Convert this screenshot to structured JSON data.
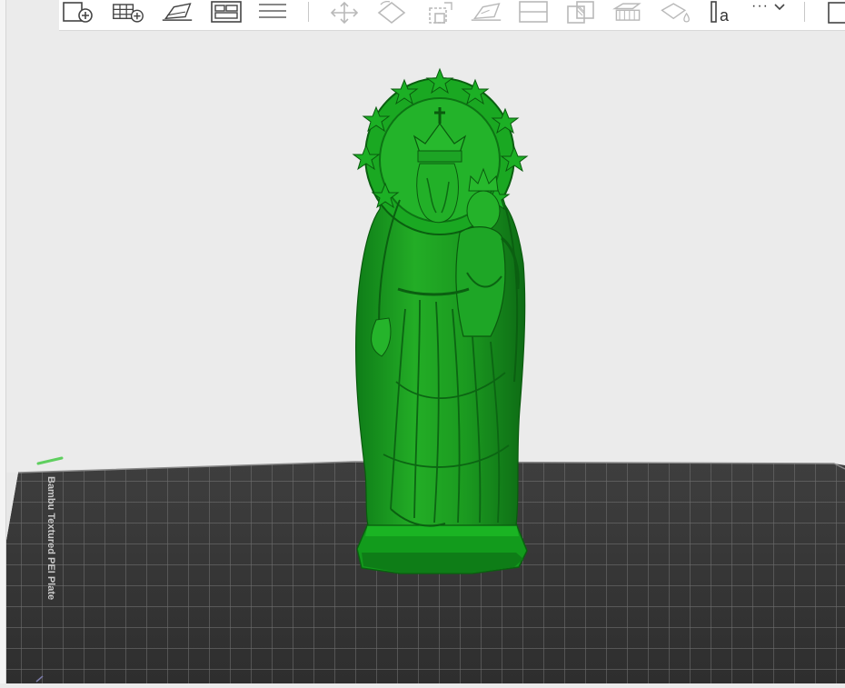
{
  "app": {
    "name": "3D slicer preparation view"
  },
  "toolbar": {
    "buttons": [
      {
        "id": "add-plate",
        "icon": "add-plate-icon"
      },
      {
        "id": "arrange-grid",
        "icon": "grid-add-icon"
      },
      {
        "id": "orient-place",
        "icon": "place-on-face-icon"
      },
      {
        "id": "layout-panels",
        "icon": "layout-icon"
      },
      {
        "id": "layers",
        "icon": "layers-icon"
      },
      {
        "id": "move",
        "icon": "move-icon"
      },
      {
        "id": "rotate",
        "icon": "rotate-icon"
      },
      {
        "id": "scale",
        "icon": "scale-icon"
      },
      {
        "id": "lay-on-face",
        "icon": "lay-on-face-icon"
      },
      {
        "id": "cut",
        "icon": "cut-icon"
      },
      {
        "id": "boolean",
        "icon": "boolean-icon"
      },
      {
        "id": "support-paint",
        "icon": "support-paint-icon"
      },
      {
        "id": "color-paint",
        "icon": "color-paint-icon"
      },
      {
        "id": "text-emboss",
        "icon": "text-emboss-icon"
      }
    ],
    "text_tool_glyph": "a",
    "more_label": "···"
  },
  "plate": {
    "label": "Bambu Textured PEI Plate",
    "colors": {
      "background": "#ebebeb",
      "plate": "#3a3a3a",
      "grid": "#6e6e6e",
      "model": "#1fa31f",
      "model_dark": "#0c6a12",
      "model_light": "#3ccd3c"
    }
  },
  "model": {
    "name": "statue-madonna-with-child"
  }
}
